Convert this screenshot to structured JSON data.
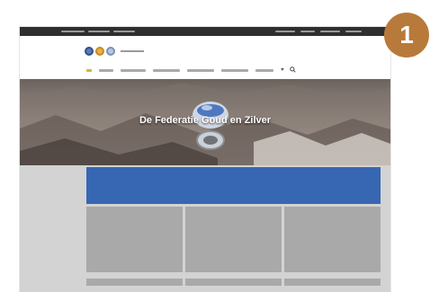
{
  "hero": {
    "title": "De Federatie Goud en Zilver"
  },
  "step_badge": {
    "number": "1"
  },
  "nav": {
    "icons": [
      "heart-icon",
      "search-icon"
    ]
  },
  "colors": {
    "banner": "#3767b2",
    "badge": "#b87a3a",
    "topbar": "#2f2f2f",
    "placeholder": "#a9a9a9",
    "content_bg": "#d3d3d3"
  }
}
